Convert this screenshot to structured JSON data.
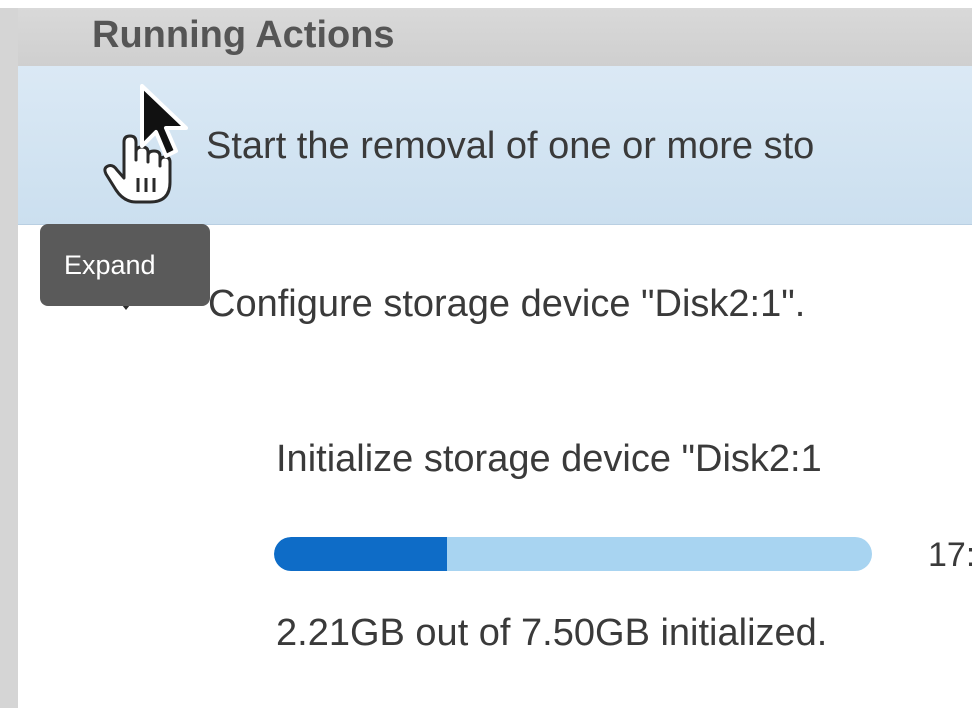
{
  "header": {
    "title": "Running Actions"
  },
  "actions": {
    "selected_label": "Start the removal of one or more sto",
    "configure_label": "Configure storage device \"Disk2:1\".",
    "expand_tooltip": "Expand"
  },
  "progress": {
    "sub_action": "Initialize storage device \"Disk2:1",
    "fraction": 0.29,
    "percent_label": "17:",
    "detail": "2.21GB out of 7.50GB initialized."
  },
  "colors": {
    "selected_row": "#d3e4f2",
    "progress_fill": "#0e6cc7",
    "progress_track": "#a8d4f1",
    "tooltip_bg": "#5a5a5a"
  },
  "icons": {
    "chevron": "chevron-down-icon",
    "cursor": "arrow-cursor-icon",
    "hand": "hand-pointer-icon"
  }
}
